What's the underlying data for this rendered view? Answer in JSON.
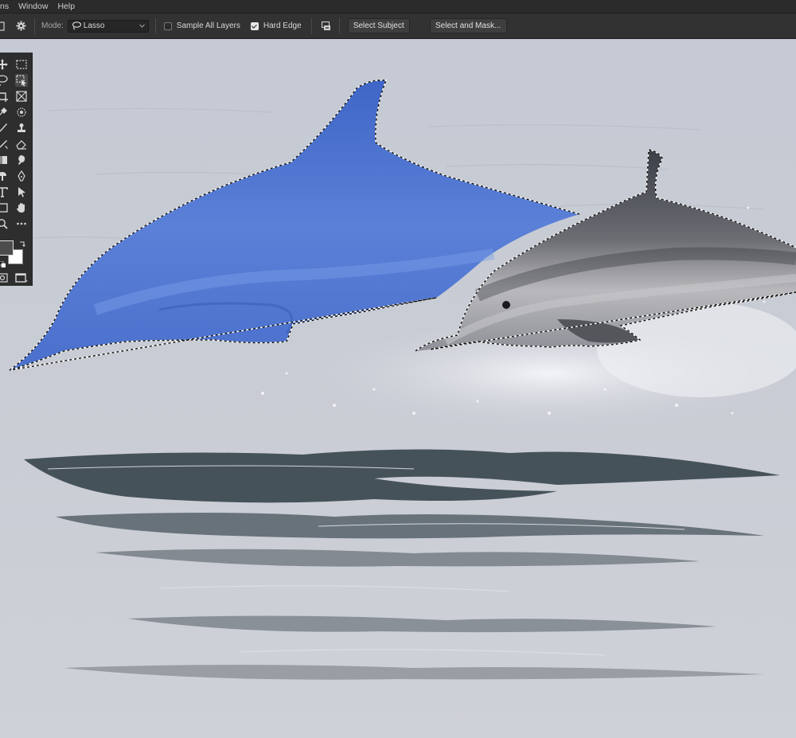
{
  "menu": {
    "items": [
      "ns",
      "Window",
      "Help"
    ]
  },
  "options": {
    "mode_label": "Mode:",
    "mode_value": "Lasso",
    "sample_all_layers_label": "Sample All Layers",
    "sample_all_layers_checked": false,
    "hard_edge_label": "Hard Edge",
    "hard_edge_checked": true,
    "select_subject_label": "Select Subject",
    "select_mask_label": "Select and Mask..."
  },
  "icons": {
    "mode_lasso": "lasso-icon",
    "settings": "gear-icon",
    "dropdown": "chevron-down-icon",
    "subtract": "selection-subtract-icon"
  },
  "colors": {
    "selection_overlay": "#4a78d8",
    "foreground_swatch": "#4d4d4d",
    "background_swatch": "#ffffff",
    "water": "#c7cbd4"
  }
}
